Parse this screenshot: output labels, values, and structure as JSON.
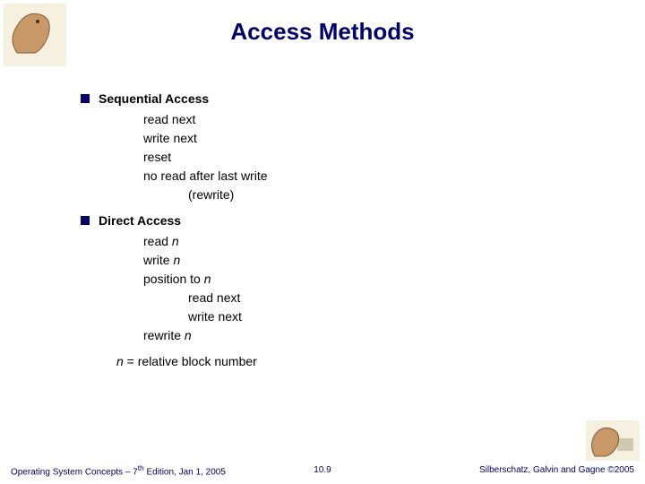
{
  "title": "Access Methods",
  "sections": [
    {
      "heading": "Sequential Access",
      "lines": [
        {
          "text": "read next",
          "indent": 1
        },
        {
          "text": "write next",
          "indent": 1
        },
        {
          "text": "reset",
          "indent": 1
        },
        {
          "text": "no read after last write",
          "indent": 1
        },
        {
          "text": "(rewrite)",
          "indent": 2
        }
      ]
    },
    {
      "heading": "Direct Access",
      "lines": [
        {
          "prefix": "read ",
          "italic": "n",
          "indent": 1
        },
        {
          "prefix": "write ",
          "italic": "n",
          "indent": 1
        },
        {
          "prefix": "position to ",
          "italic": "n",
          "indent": 1
        },
        {
          "text": "read next",
          "indent": 2
        },
        {
          "text": "write next",
          "indent": 2
        },
        {
          "prefix": "rewrite ",
          "italic": "n",
          "indent": 1
        }
      ]
    }
  ],
  "note": {
    "italic": "n",
    "rest": " = relative block number"
  },
  "footer": {
    "left_a": "Operating System Concepts – 7",
    "left_sup": "th",
    "left_b": " Edition, Jan 1, 2005",
    "center": "10.9",
    "right": "Silberschatz, Galvin and Gagne ©2005"
  }
}
